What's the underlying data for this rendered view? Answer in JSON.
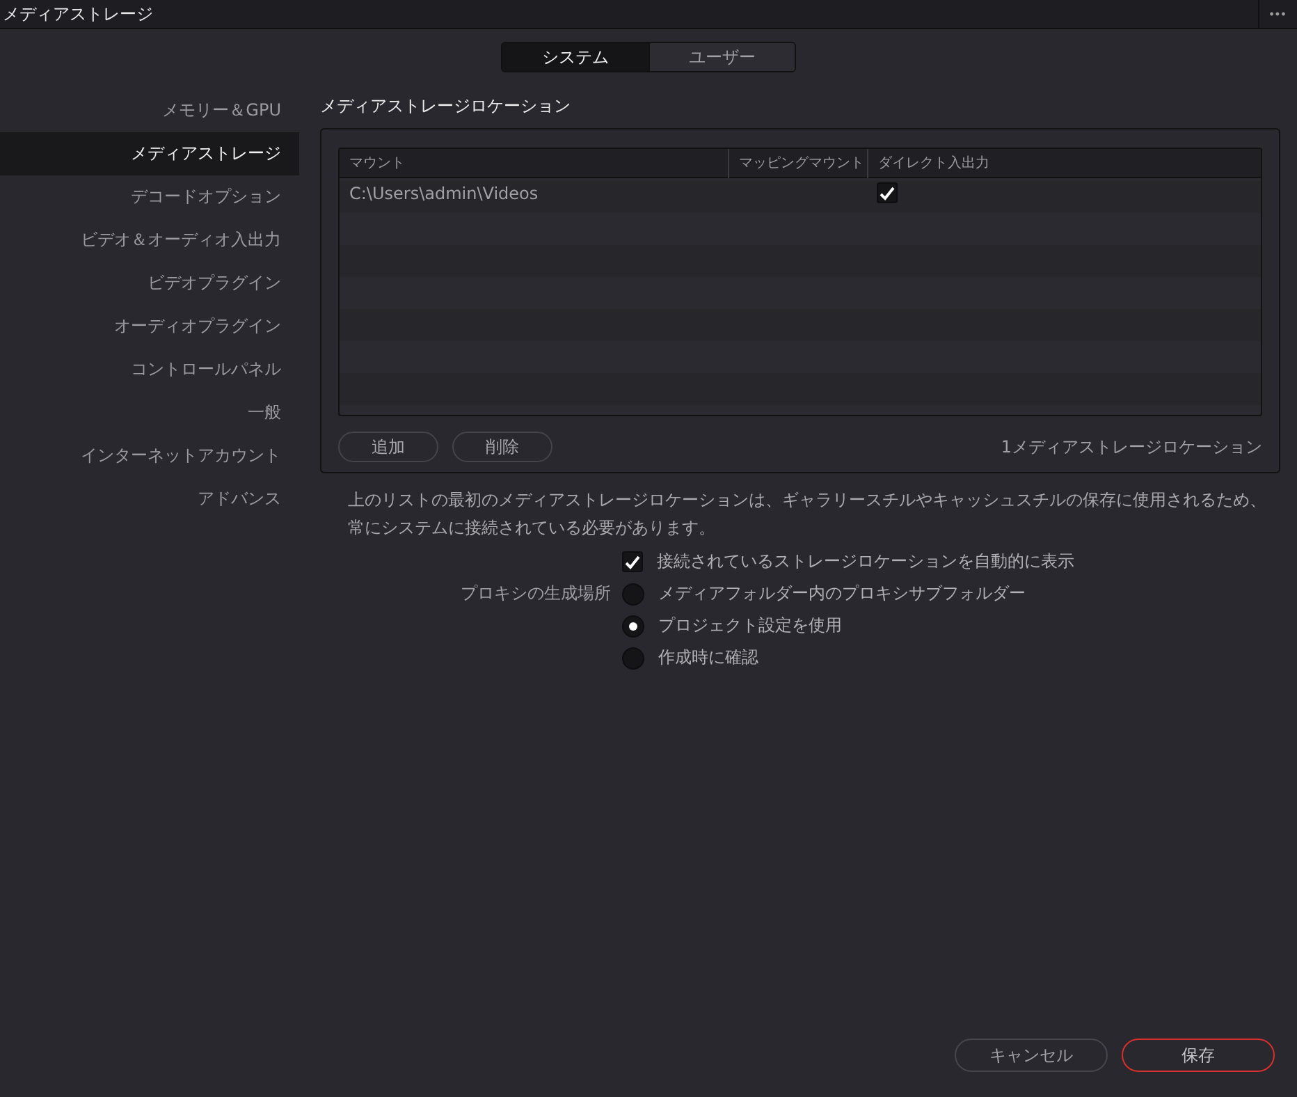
{
  "window": {
    "title": "メディアストレージ",
    "menu": "•••"
  },
  "tabs": [
    {
      "label": "システム",
      "selected": true
    },
    {
      "label": "ユーザー",
      "selected": false
    }
  ],
  "sidebar": {
    "items": [
      {
        "label": "メモリー＆GPU",
        "selected": false
      },
      {
        "label": "メディアストレージ",
        "selected": true
      },
      {
        "label": "デコードオプション",
        "selected": false
      },
      {
        "label": "ビデオ＆オーディオ入出力",
        "selected": false
      },
      {
        "label": "ビデオプラグイン",
        "selected": false
      },
      {
        "label": "オーディオプラグイン",
        "selected": false
      },
      {
        "label": "コントロールパネル",
        "selected": false
      },
      {
        "label": "一般",
        "selected": false
      },
      {
        "label": "インターネットアカウント",
        "selected": false
      },
      {
        "label": "アドバンス",
        "selected": false
      }
    ]
  },
  "section_title": "メディアストレージロケーション",
  "table": {
    "columns": [
      "マウント",
      "マッピングマウント",
      "ダイレクト入出力"
    ],
    "rows": [
      {
        "mount": "C:\\Users\\admin\\Videos",
        "direct_io": true
      }
    ]
  },
  "table_buttons": [
    "追加",
    "削除"
  ],
  "location_count": "1メディアストレージロケーション",
  "note": "上のリストの最初のメディアストレージロケーションは、ギャラリースチルやキャッシュスチルの保存に使用されるため、常にシステムに接続されている必要があります。",
  "auto_show": {
    "label": "接続されているストレージロケーションを自動的に表示",
    "checked": true
  },
  "proxy": {
    "label": "プロキシの生成場所",
    "options": [
      {
        "label": "メディアフォルダー内のプロキシサブフォルダー",
        "selected": false
      },
      {
        "label": "プロジェクト設定を使用",
        "selected": true
      },
      {
        "label": "作成時に確認",
        "selected": false
      }
    ]
  },
  "footer": {
    "cancel": "キャンセル",
    "save": "保存"
  }
}
